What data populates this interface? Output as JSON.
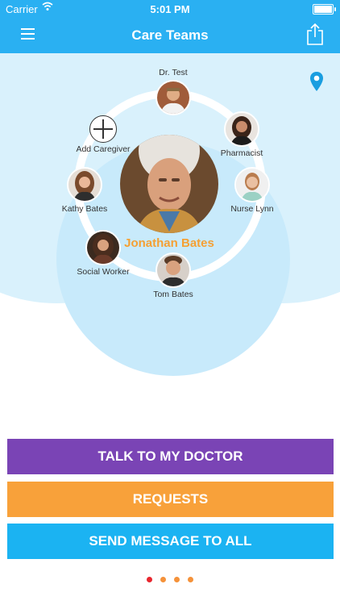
{
  "status_bar": {
    "carrier": "Carrier",
    "time": "5:01 PM"
  },
  "nav": {
    "title": "Care Teams",
    "menu_icon": "hamburger-menu-icon",
    "share_icon": "share-icon"
  },
  "patient": {
    "name": "Jonathan Bates"
  },
  "team": {
    "doctor": "Dr. Test",
    "pharmacist": "Pharmacist",
    "nurse": "Nurse Lynn",
    "tom": "Tom Bates",
    "social_worker": "Social Worker",
    "kathy": "Kathy Bates",
    "add": "Add Caregiver"
  },
  "actions": {
    "talk": "TALK TO MY DOCTOR",
    "requests": "REQUESTS",
    "send": "SEND MESSAGE TO ALL"
  },
  "colors": {
    "nav": "#2ab0f2",
    "accent_name": "#f5a033",
    "talk": "#7a44b5",
    "requests": "#f8a13a",
    "send": "#1bb3f2",
    "page_dot_active": "#e8262e",
    "page_dot": "#f5923a"
  },
  "page_indicator": {
    "count": 4,
    "active": 0
  }
}
